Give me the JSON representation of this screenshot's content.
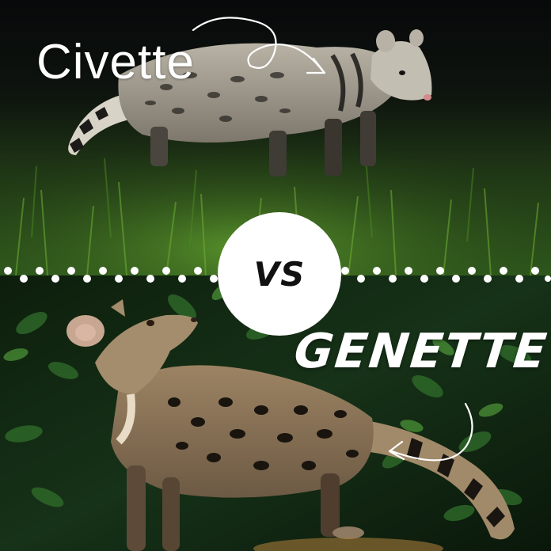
{
  "labels": {
    "top_animal": "Civette",
    "versus": "VS",
    "bottom_animal": "GENETTE"
  },
  "colors": {
    "text": "#ffffff",
    "vs_circle": "#ffffff",
    "vs_text": "#111111",
    "divider_dots": "#ffffff"
  },
  "icons": {
    "top_arrow": "curved-arrow-icon",
    "bottom_arrow": "curved-arrow-icon"
  }
}
